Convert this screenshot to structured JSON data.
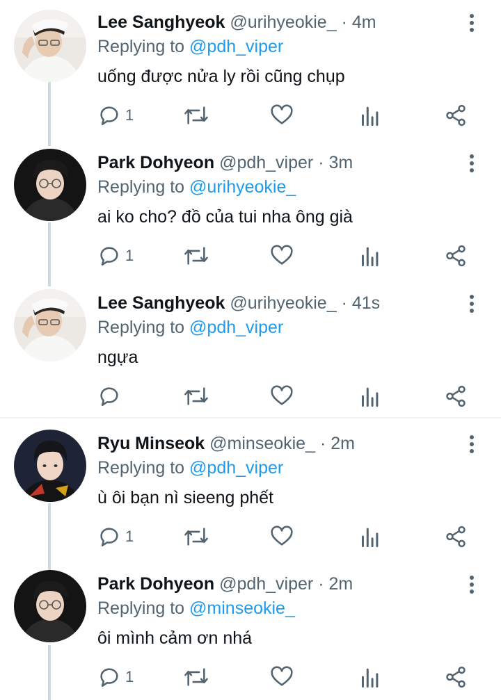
{
  "tweets": [
    {
      "name": "Lee Sanghyeok",
      "handle": "@urihyeokie_",
      "sep": "·",
      "time": "4m",
      "replying_label": "Replying to",
      "replying_to": "@pdh_viper",
      "text": "uống được nửa ly rồi cũng chụp",
      "reply_count": "1",
      "avatar_icon": "avatar-photo"
    },
    {
      "name": "Park Dohyeon",
      "handle": "@pdh_viper",
      "sep": "·",
      "time": "3m",
      "replying_label": "Replying to",
      "replying_to": "@urihyeokie_",
      "text": "ai ko cho? đồ của tui nha ông già",
      "reply_count": "1",
      "avatar_icon": "avatar-photo"
    },
    {
      "name": "Lee Sanghyeok",
      "handle": "@urihyeokie_",
      "sep": "·",
      "time": "41s",
      "replying_label": "Replying to",
      "replying_to": "@pdh_viper",
      "text": "ngựa",
      "reply_count": "",
      "avatar_icon": "avatar-photo"
    },
    {
      "name": "Ryu Minseok",
      "handle": "@minseokie_",
      "sep": "·",
      "time": "2m",
      "replying_label": "Replying to",
      "replying_to": "@pdh_viper",
      "text": "ù ôi bạn nì sieeng phết",
      "reply_count": "1",
      "avatar_icon": "avatar-photo"
    },
    {
      "name": "Park Dohyeon",
      "handle": "@pdh_viper",
      "sep": "·",
      "time": "2m",
      "replying_label": "Replying to",
      "replying_to": "@minseokie_",
      "text": "ôi mình cảm ơn nhá",
      "reply_count": "1",
      "avatar_icon": "avatar-photo"
    }
  ],
  "colors": {
    "text": "#0f1419",
    "muted": "#536471",
    "link": "#1d9bf0",
    "thread_line": "#cfd9de"
  }
}
